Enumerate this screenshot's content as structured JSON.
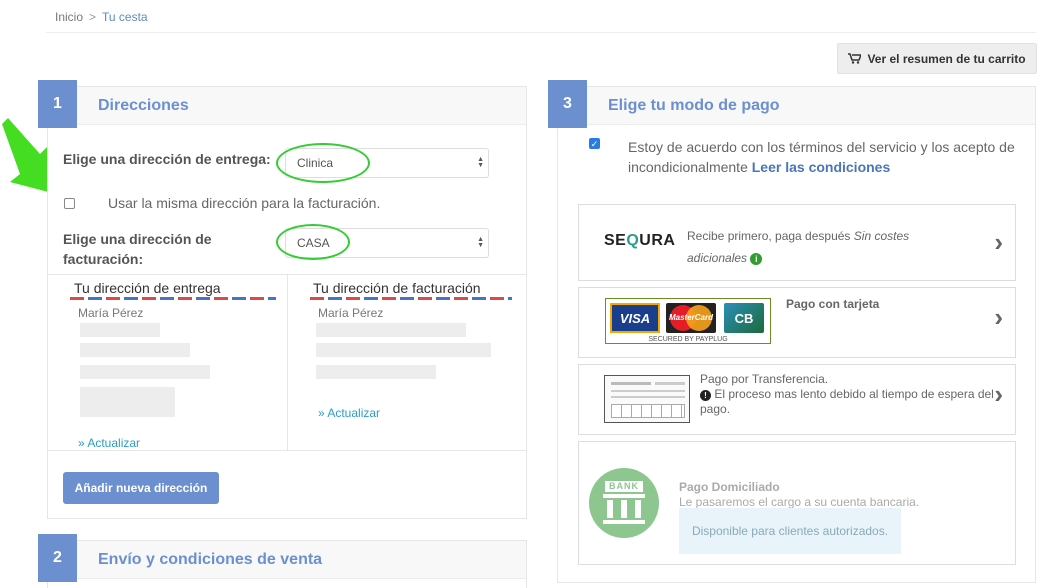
{
  "breadcrumb": {
    "home": "Inicio",
    "separator": ">",
    "current": "Tu cesta"
  },
  "cart_summary_button": "Ver el resumen de tu carrito",
  "step1": {
    "number": "1",
    "title": "Direcciones",
    "delivery_label": "Elige una dirección de entrega:",
    "delivery_selected": "Clinica",
    "same_address_label": "Usar la misma dirección para la facturación.",
    "billing_label_line1": "Elige una dirección de",
    "billing_label_line2": "facturación:",
    "billing_selected": "CASA",
    "delivery_box": {
      "title": "Tu dirección de entrega",
      "name": "María Pérez",
      "update": "» Actualizar"
    },
    "billing_box": {
      "title": "Tu dirección de facturación",
      "name": "María Pérez",
      "update": "» Actualizar"
    },
    "add_address_button": "Añadir nueva dirección"
  },
  "step2": {
    "number": "2",
    "title": "Envío y condiciones de venta"
  },
  "step3": {
    "number": "3",
    "title": "Elige tu modo de pago",
    "terms_text": "Estoy de acuerdo con los términos del servicio y los acepto de incondicionalmente",
    "terms_link": "Leer las condiciones",
    "options": {
      "sequra": {
        "logo_left": "SE",
        "logo_mark": "Q",
        "logo_right": "URA",
        "desc_line1": "Recibe primero, paga después",
        "desc_line1_italic": "Sin costes",
        "desc_line2_italic": "adicionales"
      },
      "card": {
        "title": "Pago con tarjeta",
        "visa": "VISA",
        "mastercard": "MasterCard",
        "cb": "CB",
        "secured": "SECURED BY PAYPLUG"
      },
      "transfer": {
        "title": "Pago por Transferencia.",
        "note": "El proceso mas lento debido al tiempo de espera del pago."
      },
      "direct_debit": {
        "bank_label": "BANK",
        "title": "Pago Domiciliado",
        "subtitle": "Le pasaremos el cargo a su cuenta bancaria.",
        "notice": "Disponible para clientes autorizados."
      }
    }
  },
  "colors": {
    "accent": "#6b8fcf",
    "link": "#2b9dc7",
    "highlight": "#33cc33",
    "bank_green": "#8dc78f"
  }
}
